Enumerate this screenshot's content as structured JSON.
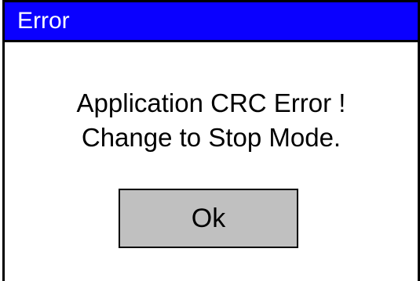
{
  "dialog": {
    "title": "Error",
    "message_line_1": "Application CRC Error !",
    "message_line_2": "Change to Stop Mode.",
    "ok_label": "Ok"
  },
  "colors": {
    "title_bar": "#0a00ff",
    "title_text": "#ffffff",
    "button_bg": "#c0c0c0",
    "frame": "#000000"
  }
}
